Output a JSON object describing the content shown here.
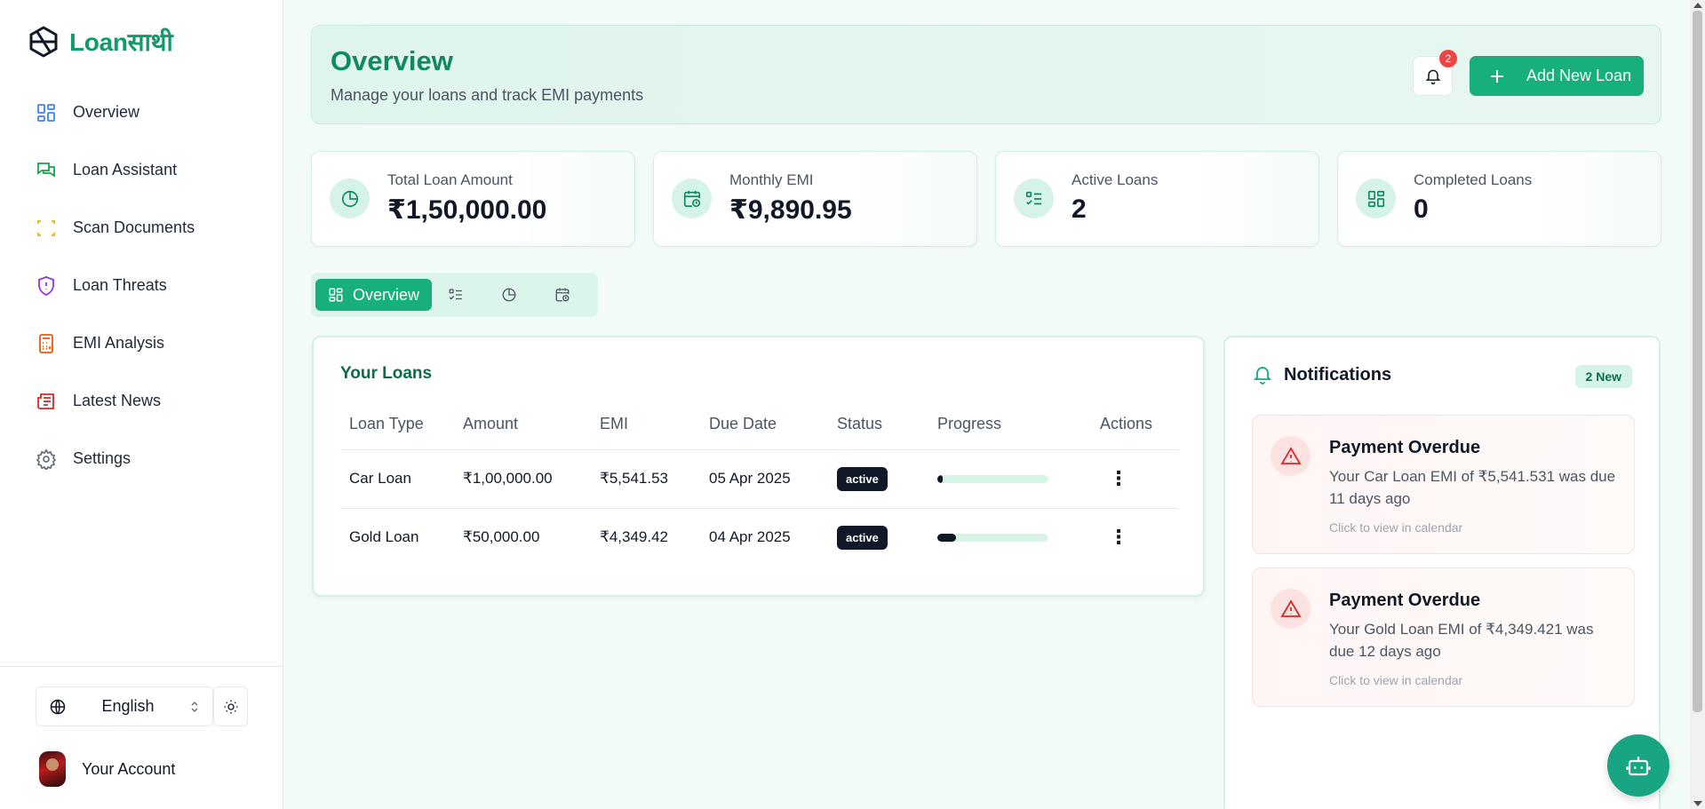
{
  "app": {
    "name": "Loanसाथी"
  },
  "sidebar": {
    "items": [
      {
        "label": "Overview",
        "icon": "grid-icon",
        "color": "#3b82f6"
      },
      {
        "label": "Loan Assistant",
        "icon": "chat-icon",
        "color": "#16a34a"
      },
      {
        "label": "Scan Documents",
        "icon": "scan-icon",
        "color": "#eab308"
      },
      {
        "label": "Loan Threats",
        "icon": "shield-alert-icon",
        "color": "#9333ea"
      },
      {
        "label": "EMI Analysis",
        "icon": "calculator-icon",
        "color": "#ea580c"
      },
      {
        "label": "Latest News",
        "icon": "newspaper-icon",
        "color": "#dc2626"
      },
      {
        "label": "Settings",
        "icon": "gear-icon",
        "color": "#6b7280"
      }
    ],
    "language": "English",
    "account_label": "Your Account"
  },
  "header": {
    "title": "Overview",
    "subtitle": "Manage your loans and track EMI payments",
    "notification_count": "2",
    "add_button": "Add New Loan"
  },
  "stats": [
    {
      "label": "Total Loan Amount",
      "value": "₹1,50,000.00"
    },
    {
      "label": "Monthly EMI",
      "value": "₹9,890.95"
    },
    {
      "label": "Active Loans",
      "value": "2"
    },
    {
      "label": "Completed Loans",
      "value": "0"
    }
  ],
  "tabs": {
    "active_label": "Overview"
  },
  "loans": {
    "title": "Your Loans",
    "columns": [
      "Loan Type",
      "Amount",
      "EMI",
      "Due Date",
      "Status",
      "Progress",
      "Actions"
    ],
    "rows": [
      {
        "type": "Car Loan",
        "amount": "₹1,00,000.00",
        "emi": "₹5,541.53",
        "due": "05 Apr 2025",
        "status": "active",
        "progress": 0.05
      },
      {
        "type": "Gold Loan",
        "amount": "₹50,000.00",
        "emi": "₹4,349.42",
        "due": "04 Apr 2025",
        "status": "active",
        "progress": 0.17
      }
    ]
  },
  "notifications": {
    "title": "Notifications",
    "badge": "2 New",
    "items": [
      {
        "title": "Payment Overdue",
        "desc": "Your Car Loan EMI of ₹5,541.531 was due 11 days ago",
        "hint": "Click to view in calendar"
      },
      {
        "title": "Payment Overdue",
        "desc": "Your Gold Loan EMI of ₹4,349.421 was due 12 days ago",
        "hint": "Click to view in calendar"
      }
    ]
  },
  "colors": {
    "brand": "#17b07a",
    "brand_dark": "#0f8a5f",
    "danger": "#ef4444"
  }
}
